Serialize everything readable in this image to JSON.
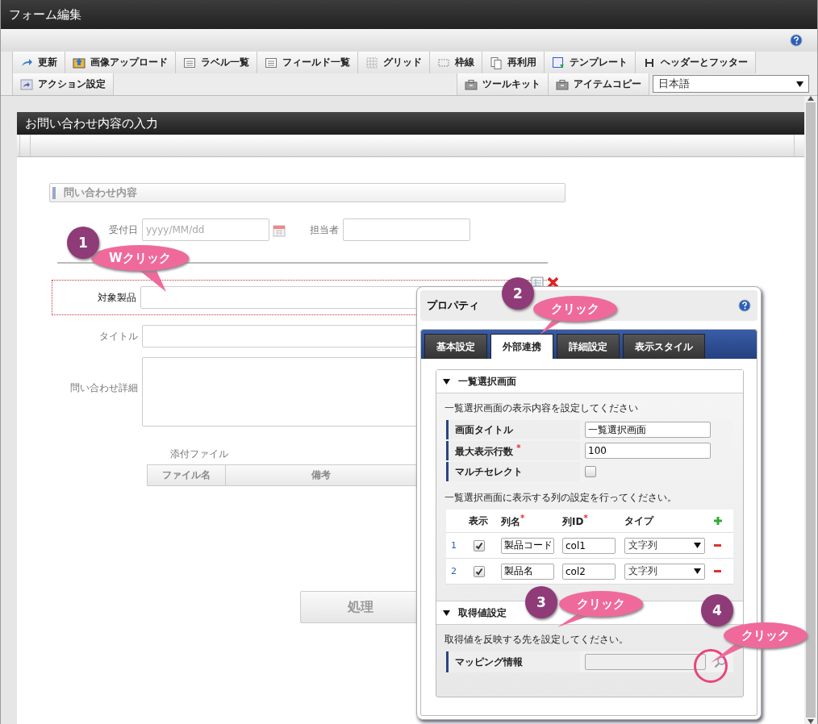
{
  "window": {
    "title": "フォーム編集"
  },
  "toolbar": {
    "row1": [
      {
        "label": "更新",
        "kind": "refresh"
      },
      {
        "label": "画像アップロード",
        "kind": "upload"
      },
      {
        "label": "ラベル一覧",
        "kind": "list"
      },
      {
        "label": "フィールド一覧",
        "kind": "list"
      },
      {
        "label": "グリッド",
        "kind": "grid"
      },
      {
        "label": "枠線",
        "kind": "frame"
      },
      {
        "label": "再利用",
        "kind": "copy"
      },
      {
        "label": "テンプレート",
        "kind": "template"
      },
      {
        "label": "ヘッダーとフッター",
        "kind": "header"
      }
    ],
    "row2_left": [
      {
        "label": "アクション設定",
        "kind": "action"
      }
    ],
    "row2_right": [
      {
        "label": "ツールキット",
        "kind": "kit"
      },
      {
        "label": "アイテムコピー",
        "kind": "kit"
      }
    ],
    "language": "日本語"
  },
  "form": {
    "title": "お問い合わせ内容の入力",
    "section": "問い合わせ内容",
    "date_field": {
      "label": "受付日",
      "placeholder": "yyyy/MM/dd"
    },
    "person_field": {
      "label": "担当者"
    },
    "fields": [
      {
        "label": "対象製品",
        "kind": "text",
        "selected": true
      },
      {
        "label": "タイトル",
        "kind": "text",
        "selected": false
      },
      {
        "label": "問い合わせ詳細",
        "kind": "textarea",
        "selected": false
      }
    ],
    "attachments": {
      "label": "添付ファイル",
      "columns": [
        "ファイル名",
        "備考"
      ]
    },
    "process_button": "処理"
  },
  "properties": {
    "title": "プロパティ",
    "tabs": [
      {
        "label": "基本設定",
        "selected": false
      },
      {
        "label": "外部連携",
        "selected": true
      },
      {
        "label": "詳細設定",
        "selected": false
      },
      {
        "label": "表示スタイル",
        "selected": false
      }
    ],
    "list_section": {
      "title": "一覧選択画面",
      "description": "一覧選択画面の表示内容を設定してください",
      "rows": [
        {
          "label": "画面タイトル",
          "kind": "text",
          "value": "一覧選択画面"
        },
        {
          "label": "最大表示行数 $^{*}$",
          "kind": "text",
          "value": "100"
        },
        {
          "label": "マルチセレクト",
          "kind": "checkbox",
          "checked": false
        }
      ],
      "columns_note": "一覧選択画面に表示する列の設定を行ってください。",
      "columns": [
        "表示",
        "列名$^{*}$",
        "列ID$^{*}$",
        "タイプ"
      ],
      "column_rows": [
        {
          "index": "1",
          "shown": true,
          "name": "製品コード",
          "id": "col1",
          "type": "文字列"
        },
        {
          "index": "2",
          "shown": true,
          "name": "製品名",
          "id": "col2",
          "type": "文字列"
        }
      ]
    },
    "value_section": {
      "title": "取得値設定",
      "description": "取得値を反映する先を設定してください。",
      "mapping_label": "マッピング情報"
    }
  },
  "callouts": [
    {
      "number": "1",
      "label": "Wクリック"
    },
    {
      "number": "2",
      "label": "クリック"
    },
    {
      "number": "3",
      "label": "クリック"
    },
    {
      "number": "4",
      "label": "クリック"
    }
  ]
}
